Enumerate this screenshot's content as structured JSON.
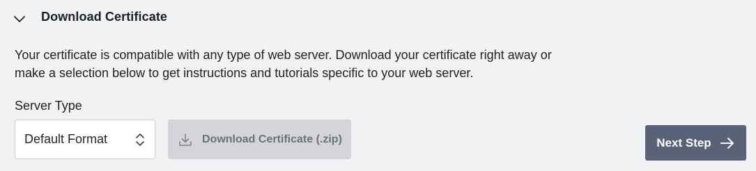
{
  "section": {
    "title": "Download Certificate",
    "expanded": true,
    "description": "Your certificate is compatible with any type of web server. Download your certificate right away or make a selection below to get instructions and tutorials specific to your web server."
  },
  "server_type": {
    "label": "Server Type",
    "selected": "Default Format"
  },
  "actions": {
    "download_label": "Download Certificate (.zip)",
    "download_icon": "download-icon",
    "next_label": "Next Step",
    "next_icon": "arrow-right-icon"
  },
  "colors": {
    "background": "#f1f2f4",
    "next_button": "#5a6278",
    "download_button_disabled": "#d3d5d9"
  }
}
